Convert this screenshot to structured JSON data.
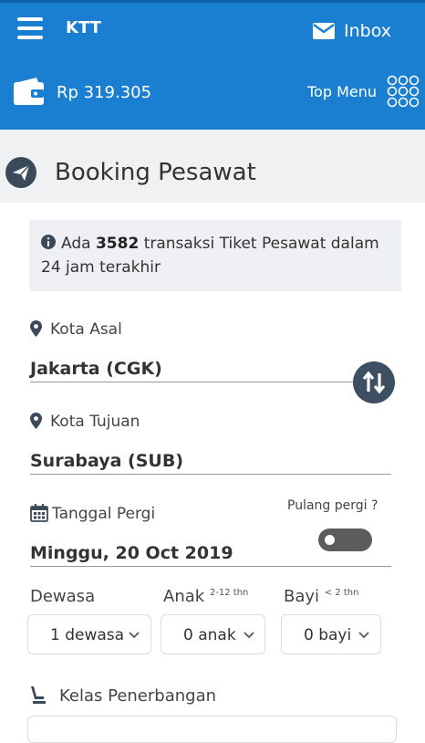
{
  "header": {
    "app_name": "KTT",
    "inbox_label": "Inbox",
    "balance": "Rp 319.305",
    "top_menu_label": "Top Menu"
  },
  "page": {
    "title": "Booking Pesawat"
  },
  "info": {
    "prefix": "Ada",
    "count": "3582",
    "suffix": "transaksi Tiket Pesawat dalam 24 jam terakhir"
  },
  "origin": {
    "label": "Kota Asal",
    "value": "Jakarta (CGK)"
  },
  "destination": {
    "label": "Kota Tujuan",
    "value": "Surabaya (SUB)"
  },
  "departure": {
    "label": "Tanggal Pergi",
    "value": "Minggu, 20 Oct 2019"
  },
  "round_trip": {
    "label": "Pulang pergi ?",
    "enabled": false
  },
  "passengers": {
    "adult_label": "Dewasa",
    "adult_value": "1 dewasa",
    "child_label": "Anak",
    "child_note": "2-12 thn",
    "child_value": "0 anak",
    "infant_label": "Bayi",
    "infant_note": "< 2 thn",
    "infant_value": "0 bayi"
  },
  "cabin": {
    "label": "Kelas Penerbangan"
  },
  "colors": {
    "primary": "#1a7fd0",
    "dark": "#3d4f61"
  }
}
